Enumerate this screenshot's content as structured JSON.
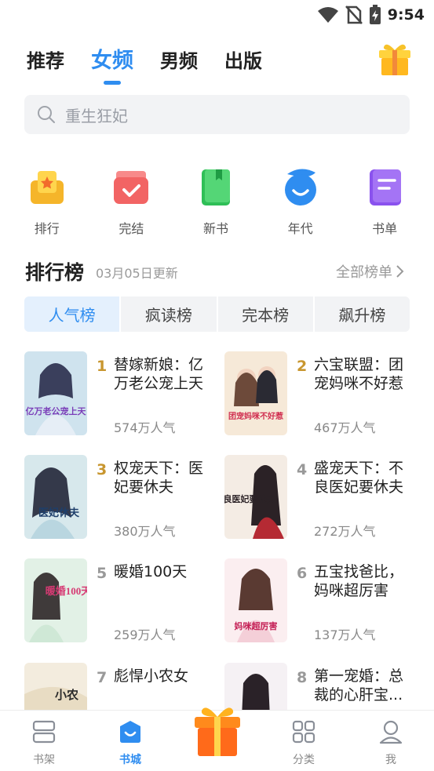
{
  "status": {
    "time": "9:54"
  },
  "top_tabs": [
    "推荐",
    "女频",
    "男频",
    "出版"
  ],
  "active_tab": 1,
  "search": {
    "placeholder": "重生狂妃"
  },
  "quick_entries": [
    {
      "label": "排行",
      "icon": "trophy-icon",
      "color": "#f5b52a"
    },
    {
      "label": "完结",
      "icon": "check-icon",
      "color": "#f26464"
    },
    {
      "label": "新书",
      "icon": "book-icon",
      "color": "#2fbf57"
    },
    {
      "label": "年代",
      "icon": "smile-icon",
      "color": "#2f8df0"
    },
    {
      "label": "书单",
      "icon": "list-icon",
      "color": "#8a52ee"
    }
  ],
  "ranking": {
    "title": "排行榜",
    "updated": "03月05日更新",
    "all_link": "全部榜单",
    "tabs": [
      "人气榜",
      "疯读榜",
      "完本榜",
      "飙升榜"
    ],
    "active_tab": 0,
    "books": [
      {
        "rank": "1",
        "title": "替嫁新娘：亿万老公宠上天",
        "popularity": "574万人气",
        "cover_text": "亿万老公宠上天"
      },
      {
        "rank": "2",
        "title": "六宝联盟：团宠妈咪不好惹",
        "popularity": "467万人气",
        "cover_text": "团宠妈咪不好惹"
      },
      {
        "rank": "3",
        "title": "权宠天下：医妃要休夫",
        "popularity": "380万人气",
        "cover_text": "医妃休夫"
      },
      {
        "rank": "4",
        "title": "盛宠天下：不良医妃要休夫",
        "popularity": "272万人气",
        "cover_text": "不良医妃要休夫"
      },
      {
        "rank": "5",
        "title": "暖婚100天",
        "popularity": "259万人气",
        "cover_text": "暖婚100天"
      },
      {
        "rank": "6",
        "title": "五宝找爸比，妈咪超厉害",
        "popularity": "137万人气",
        "cover_text": "妈咪超厉害"
      },
      {
        "rank": "7",
        "title": "彪悍小农女",
        "popularity": "",
        "cover_text": "小农"
      },
      {
        "rank": "8",
        "title": "第一宠婚：总裁的心肝宝...",
        "popularity": "",
        "cover_text": ""
      }
    ]
  },
  "bottom_nav": [
    {
      "label": "书架",
      "icon": "bookshelf-icon"
    },
    {
      "label": "书城",
      "icon": "bookstore-icon"
    },
    {
      "label": "",
      "icon": "gift-icon"
    },
    {
      "label": "分类",
      "icon": "category-grid-icon"
    },
    {
      "label": "我",
      "icon": "profile-icon"
    }
  ],
  "colors": {
    "accent": "#2f8df0",
    "rank_gold": "#c8962f"
  }
}
